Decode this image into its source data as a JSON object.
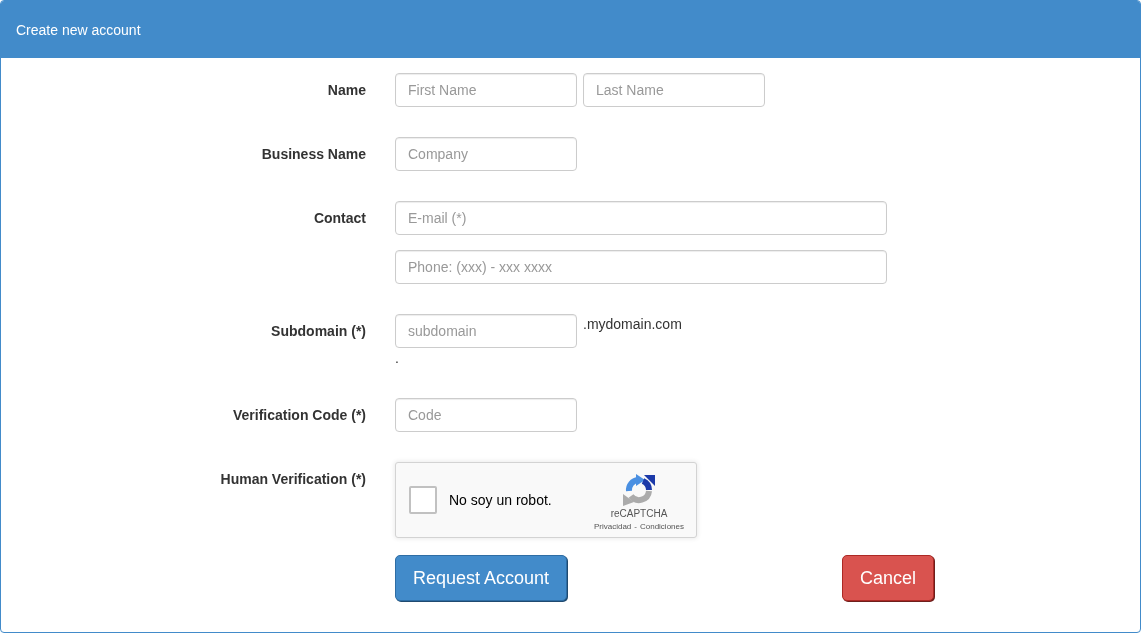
{
  "panel": {
    "title": "Create new account"
  },
  "rows": [
    {
      "kind": "pair",
      "label": "Name",
      "inputs": [
        {
          "placeholder": "First Name"
        },
        {
          "placeholder": "Last Name"
        }
      ]
    },
    {
      "kind": "single",
      "label": "Business Name",
      "inputs": [
        {
          "placeholder": "Company"
        }
      ]
    },
    {
      "kind": "stack",
      "label": "Contact",
      "inputs": [
        {
          "placeholder": "E-mail (*)"
        },
        {
          "placeholder": "Phone: (xxx) - xxx xxxx"
        }
      ]
    },
    {
      "kind": "subdomain",
      "label": "Subdomain (*)",
      "inputs": [
        {
          "placeholder": "subdomain"
        }
      ],
      "suffix": ".mydomain.com",
      "note": "."
    },
    {
      "kind": "single",
      "label": "Verification Code (*)",
      "inputs": [
        {
          "placeholder": "Code"
        }
      ]
    },
    {
      "kind": "captcha",
      "label": "Human Verification (*)",
      "captcha": {
        "checked": false,
        "text": "No soy un robot.",
        "brand": "reCAPTCHA",
        "links": [
          "Privacidad",
          "Condiciones"
        ],
        "separator": "-"
      }
    }
  ],
  "buttons": [
    {
      "kind": "primary",
      "label": "Request Account"
    },
    {
      "kind": "danger",
      "label": "Cancel"
    }
  ]
}
